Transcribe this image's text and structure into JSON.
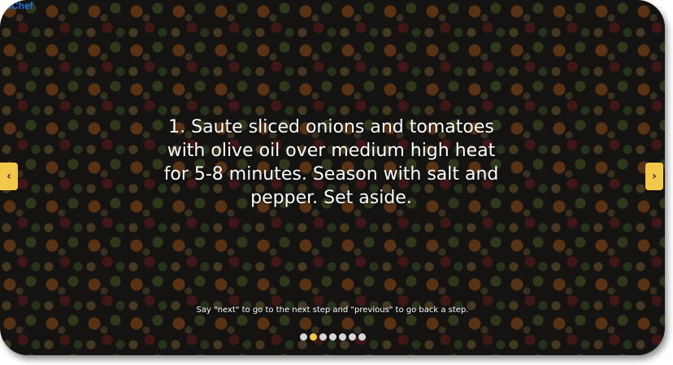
{
  "app": {
    "logo_text": "usChef"
  },
  "slide": {
    "step_text": "1. Saute sliced onions and tomatoes with olive oil over medium high heat for 5-8 minutes. Season with salt and pepper. Set aside.",
    "voice_hint": "Say \"next\" to go to the next step and \"previous\" to go back a step."
  },
  "navigation": {
    "prev_label": "‹",
    "next_label": "›",
    "prev_icon": "chevron-left-icon",
    "next_icon": "chevron-right-icon"
  },
  "pagination": {
    "total": 7,
    "active_index": 1
  },
  "colors": {
    "accent": "#f2c84b",
    "logo": "#1e6fd9",
    "dot_inactive": "#d6d6d6",
    "text": "#ffffff"
  }
}
